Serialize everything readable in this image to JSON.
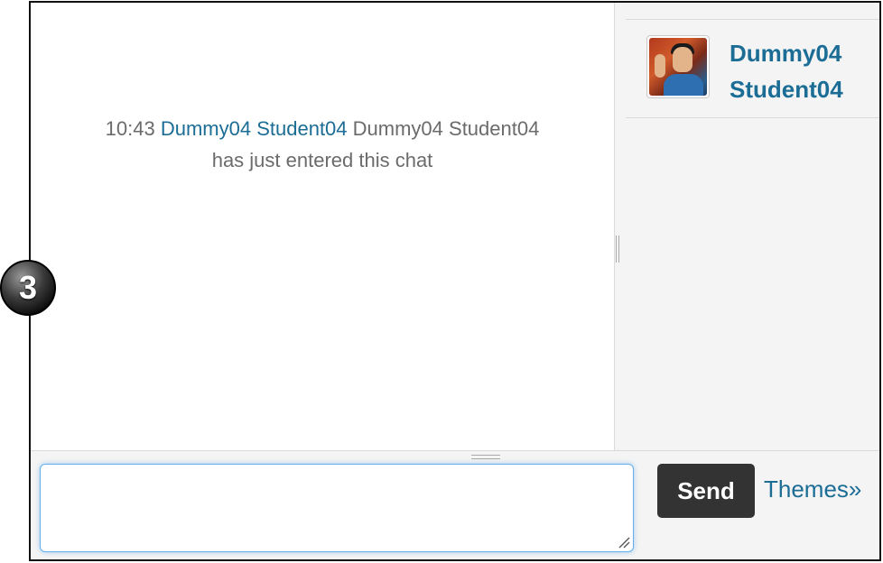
{
  "chat": {
    "message": {
      "time": "10:43",
      "user_link": "Dummy04 Student04",
      "user_name": "Dummy04 Student04",
      "text": "has just entered this chat"
    }
  },
  "users": [
    {
      "name_line1": "Dummy04",
      "name_line2": "Student04"
    }
  ],
  "composer": {
    "message_value": "",
    "send_label": "Send",
    "themes_label": "Themes»"
  },
  "callout": {
    "number": "3"
  },
  "colors": {
    "link": "#1b6d96",
    "send_bg": "#333333",
    "input_focus": "#66afe9",
    "panel_bg": "#f4f4f4"
  }
}
